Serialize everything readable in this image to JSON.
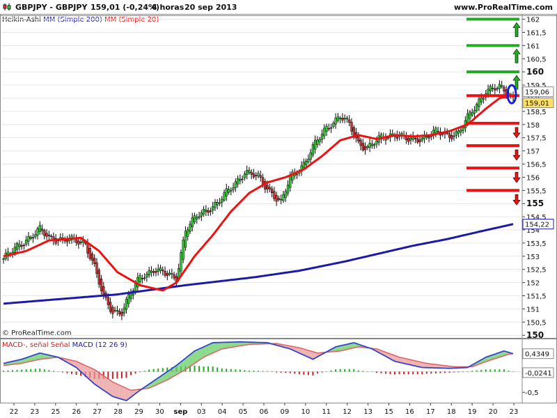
{
  "header": {
    "symbol": "GBPJPY - GBPJPY",
    "price_change": "159,01 (-0,24%)",
    "period": "4 horas",
    "date": "20 sep 2013",
    "site": "www.ProRealTime.com"
  },
  "copyright": "© ProRealTime.com",
  "colors": {
    "bull": "#33cc33",
    "bear": "#cc3333",
    "sma200": "#1a1aaa",
    "sma20": "#ee1111",
    "macd": "#3344cc",
    "signal": "#dd6666",
    "hist_pos": "#22aa22",
    "hist_neg": "#cc2222",
    "level_up": "#22aa22",
    "level_down": "#ee1111"
  },
  "chart_data": [
    {
      "type": "candlestick",
      "legend": [
        {
          "text": "Heikin-Ashi",
          "color": "#111111"
        },
        {
          "text": "MM (Simple 200)",
          "color": "#1a1aaa"
        },
        {
          "text": "MM (Simple 20)",
          "color": "#ee1111"
        }
      ],
      "x_ticks": [
        "22",
        "23",
        "25",
        "26",
        "27",
        "28",
        "29",
        "30",
        "sep",
        "03",
        "04",
        "05",
        "06",
        "09",
        "10",
        "11",
        "12",
        "13",
        "15",
        "16",
        "17",
        "18",
        "19",
        "20",
        "23"
      ],
      "y_ticks": [
        {
          "v": 162,
          "label": "162",
          "bold": false
        },
        {
          "v": 161.5,
          "label": "161,5",
          "bold": false
        },
        {
          "v": 161,
          "label": "161",
          "bold": false
        },
        {
          "v": 160.5,
          "label": "160,5",
          "bold": false
        },
        {
          "v": 160,
          "label": "160",
          "bold": true
        },
        {
          "v": 159.5,
          "label": "159,5",
          "bold": false
        },
        {
          "v": 159,
          "label": "159",
          "bold": false
        },
        {
          "v": 158.5,
          "label": "158,5",
          "bold": false
        },
        {
          "v": 158,
          "label": "158",
          "bold": false
        },
        {
          "v": 157.5,
          "label": "157,5",
          "bold": false
        },
        {
          "v": 157,
          "label": "157",
          "bold": false
        },
        {
          "v": 156.5,
          "label": "156,5",
          "bold": false
        },
        {
          "v": 156,
          "label": "156",
          "bold": false
        },
        {
          "v": 155.5,
          "label": "155,5",
          "bold": false
        },
        {
          "v": 155,
          "label": "155",
          "bold": true
        },
        {
          "v": 154.5,
          "label": "154,5",
          "bold": false
        },
        {
          "v": 154,
          "label": "154",
          "bold": false
        },
        {
          "v": 153.5,
          "label": "153,5",
          "bold": false
        },
        {
          "v": 153,
          "label": "153",
          "bold": false
        },
        {
          "v": 152.5,
          "label": "152,5",
          "bold": false
        },
        {
          "v": 152,
          "label": "152",
          "bold": false
        },
        {
          "v": 151.5,
          "label": "151,5",
          "bold": false
        },
        {
          "v": 151,
          "label": "151",
          "bold": false
        },
        {
          "v": 150.5,
          "label": "150,5",
          "bold": false
        },
        {
          "v": 150,
          "label": "150",
          "bold": true
        }
      ],
      "ylim": [
        149.9,
        162.2
      ],
      "price_tags": [
        {
          "label": "159,06",
          "value": 159.06,
          "bg": "#ffffff",
          "border": "#888888"
        },
        {
          "label": "159,01",
          "value": 159.01,
          "bg": "#ffe066",
          "border": "#888888"
        },
        {
          "label": "154,22",
          "value": 154.22,
          "bg": "#ffffff",
          "border": "#1a1aaa"
        }
      ],
      "levels_up": [
        162,
        161,
        160
      ],
      "levels_pivot": 159.1,
      "levels_down": [
        158.05,
        157.2,
        156.35,
        155.5
      ],
      "bars": 225,
      "sma200": [
        [
          0,
          151.2
        ],
        [
          50,
          151.55
        ],
        [
          80,
          151.9
        ],
        [
          110,
          152.2
        ],
        [
          130,
          152.45
        ],
        [
          150,
          152.8
        ],
        [
          165,
          153.1
        ],
        [
          180,
          153.4
        ],
        [
          195,
          153.65
        ],
        [
          210,
          153.95
        ],
        [
          224,
          154.22
        ]
      ],
      "sma20": [
        [
          0,
          153.0
        ],
        [
          10,
          153.2
        ],
        [
          20,
          153.6
        ],
        [
          34,
          153.7
        ],
        [
          42,
          153.2
        ],
        [
          50,
          152.4
        ],
        [
          60,
          151.9
        ],
        [
          70,
          151.7
        ],
        [
          76,
          152.0
        ],
        [
          84,
          153.0
        ],
        [
          92,
          153.8
        ],
        [
          100,
          154.7
        ],
        [
          108,
          155.4
        ],
        [
          116,
          155.8
        ],
        [
          124,
          156.0
        ],
        [
          132,
          156.3
        ],
        [
          140,
          156.8
        ],
        [
          148,
          157.4
        ],
        [
          156,
          157.6
        ],
        [
          164,
          157.45
        ],
        [
          172,
          157.6
        ],
        [
          180,
          157.55
        ],
        [
          188,
          157.6
        ],
        [
          196,
          157.75
        ],
        [
          204,
          158.0
        ],
        [
          212,
          158.6
        ],
        [
          218,
          159.0
        ],
        [
          224,
          159.1
        ]
      ],
      "path": [
        [
          0,
          152.9
        ],
        [
          8,
          153.5
        ],
        [
          16,
          154.0
        ],
        [
          20,
          153.7
        ],
        [
          30,
          153.6
        ],
        [
          36,
          153.5
        ],
        [
          40,
          152.6
        ],
        [
          44,
          151.4
        ],
        [
          48,
          150.9
        ],
        [
          52,
          150.9
        ],
        [
          56,
          151.6
        ],
        [
          60,
          152.2
        ],
        [
          66,
          152.5
        ],
        [
          72,
          152.3
        ],
        [
          76,
          152.2
        ],
        [
          80,
          154.0
        ],
        [
          86,
          154.6
        ],
        [
          94,
          155.0
        ],
        [
          100,
          155.6
        ],
        [
          106,
          156.2
        ],
        [
          112,
          156.0
        ],
        [
          118,
          155.4
        ],
        [
          122,
          155.0
        ],
        [
          126,
          156.0
        ],
        [
          132,
          156.5
        ],
        [
          138,
          157.4
        ],
        [
          142,
          157.9
        ],
        [
          148,
          158.3
        ],
        [
          152,
          158.0
        ],
        [
          156,
          157.3
        ],
        [
          160,
          157.1
        ],
        [
          166,
          157.5
        ],
        [
          172,
          157.65
        ],
        [
          178,
          157.4
        ],
        [
          184,
          157.5
        ],
        [
          190,
          157.7
        ],
        [
          196,
          157.6
        ],
        [
          200,
          157.7
        ],
        [
          206,
          158.5
        ],
        [
          212,
          159.3
        ],
        [
          218,
          159.4
        ],
        [
          224,
          159.0
        ]
      ]
    },
    {
      "type": "bar",
      "legend": [
        {
          "text": "MACD-, señal Señal",
          "color": "#cc2222"
        },
        {
          "text": "MACD (12 26 9)",
          "color": "#1a1aaa"
        }
      ],
      "y_ticks": [
        {
          "v": 0.4349,
          "label": "0,4349",
          "box": true
        },
        {
          "v": -0.0241,
          "label": "-0,0241",
          "box": true
        },
        {
          "v": -0.5,
          "label": "-0,5",
          "box": false
        }
      ],
      "ylim": [
        -0.75,
        0.8
      ],
      "macd": [
        [
          0,
          0.2
        ],
        [
          8,
          0.3
        ],
        [
          16,
          0.45
        ],
        [
          24,
          0.35
        ],
        [
          32,
          0.1
        ],
        [
          40,
          -0.3
        ],
        [
          48,
          -0.6
        ],
        [
          54,
          -0.7
        ],
        [
          60,
          -0.45
        ],
        [
          68,
          -0.15
        ],
        [
          76,
          0.15
        ],
        [
          84,
          0.5
        ],
        [
          92,
          0.7
        ],
        [
          104,
          0.72
        ],
        [
          116,
          0.7
        ],
        [
          126,
          0.55
        ],
        [
          136,
          0.3
        ],
        [
          146,
          0.6
        ],
        [
          154,
          0.7
        ],
        [
          162,
          0.55
        ],
        [
          172,
          0.25
        ],
        [
          184,
          0.1
        ],
        [
          196,
          0.08
        ],
        [
          204,
          0.1
        ],
        [
          212,
          0.35
        ],
        [
          220,
          0.5
        ],
        [
          224,
          0.4349
        ]
      ],
      "signal": [
        [
          0,
          0.15
        ],
        [
          8,
          0.2
        ],
        [
          16,
          0.3
        ],
        [
          24,
          0.35
        ],
        [
          32,
          0.25
        ],
        [
          40,
          0.05
        ],
        [
          48,
          -0.25
        ],
        [
          56,
          -0.45
        ],
        [
          64,
          -0.4
        ],
        [
          72,
          -0.2
        ],
        [
          80,
          0.05
        ],
        [
          88,
          0.35
        ],
        [
          96,
          0.55
        ],
        [
          108,
          0.66
        ],
        [
          120,
          0.68
        ],
        [
          130,
          0.58
        ],
        [
          138,
          0.45
        ],
        [
          148,
          0.5
        ],
        [
          156,
          0.6
        ],
        [
          164,
          0.55
        ],
        [
          174,
          0.35
        ],
        [
          186,
          0.2
        ],
        [
          198,
          0.12
        ],
        [
          206,
          0.12
        ],
        [
          214,
          0.28
        ],
        [
          222,
          0.42
        ],
        [
          224,
          0.4349
        ]
      ]
    }
  ]
}
